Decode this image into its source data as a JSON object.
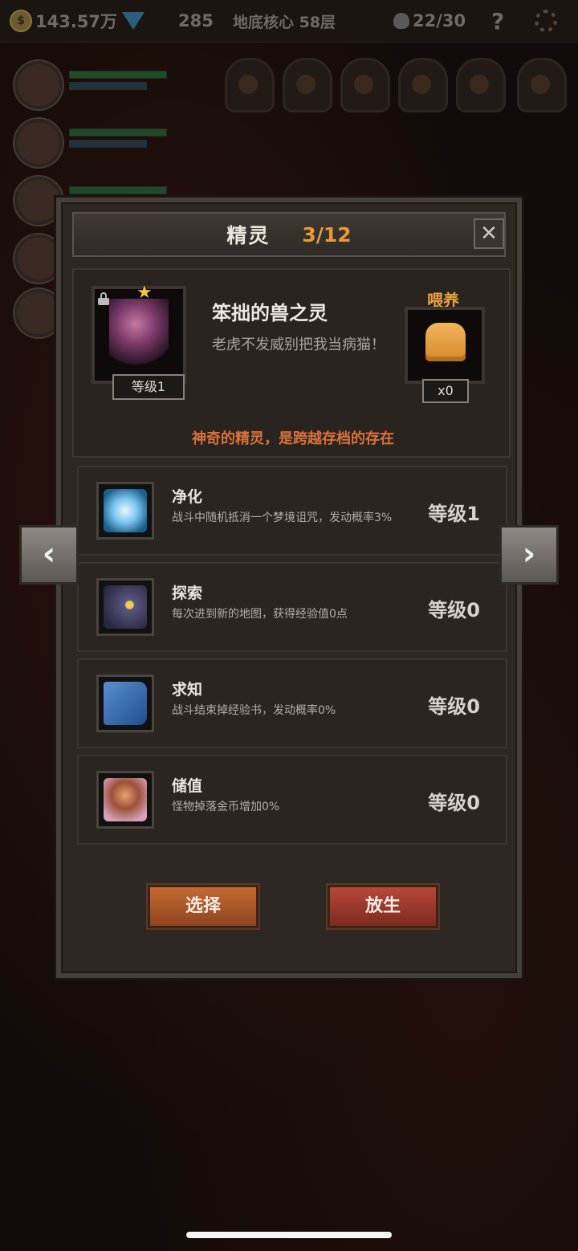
{
  "topbar": {
    "coins": "143.57万",
    "gems": "285",
    "location": "地底核心 58层",
    "kills": "22/30",
    "help": "?"
  },
  "dialog": {
    "title": "精灵",
    "count": "3/12",
    "close": "✕",
    "pet": {
      "name": "笨拙的兽之灵",
      "quote": "老虎不发威别把我当病猫！",
      "level": "等级1",
      "feed_label": "喂养",
      "feed_count": "x0",
      "tagline": "神奇的精灵，是跨越存档的存在"
    },
    "skills": [
      {
        "name": "净化",
        "desc": "战斗中随机抵消一个梦境诅咒，发动概率3%",
        "level": "等级1"
      },
      {
        "name": "探索",
        "desc": "每次进到新的地图，获得经验值0点",
        "level": "等级0"
      },
      {
        "name": "求知",
        "desc": "战斗结束掉经验书，发动概率0%",
        "level": "等级0"
      },
      {
        "name": "储值",
        "desc": "怪物掉落金币增加0%",
        "level": "等级0"
      }
    ],
    "buttons": {
      "select": "选择",
      "release": "放生"
    }
  },
  "nav": {
    "prev": "‹",
    "next": "›"
  },
  "colors": {
    "accent_orange": "#e89a3a",
    "tagline": "#d9713a",
    "select_btn": "#c46a32",
    "release_btn": "#b84838"
  }
}
